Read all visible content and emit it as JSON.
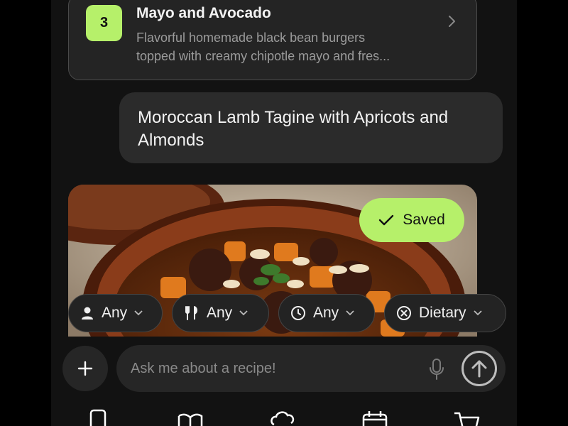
{
  "recipe_card": {
    "rank": "3",
    "title": "Mayo and Avocado",
    "description_line1": "Flavorful homemade black bean burgers",
    "description_line2": "topped with creamy chipotle mayo and fres..."
  },
  "user_message": {
    "text": "Moroccan Lamb Tagine with Apricots and Almonds"
  },
  "saved_badge": {
    "label": "Saved"
  },
  "filters": [
    {
      "label": "Any",
      "icon": "person-icon"
    },
    {
      "label": "Any",
      "icon": "utensils-icon"
    },
    {
      "label": "Any",
      "icon": "clock-icon"
    },
    {
      "label": "Dietary",
      "icon": "no-symbol-icon"
    }
  ],
  "composer": {
    "placeholder": "Ask me about a recipe!"
  },
  "bottom_nav": {
    "icons": [
      "phone-icon",
      "book-icon",
      "chef-hat-icon",
      "calendar-icon",
      "cart-icon"
    ]
  },
  "colors": {
    "accent": "#b6f06a",
    "background": "#121212",
    "card": "#242424"
  }
}
